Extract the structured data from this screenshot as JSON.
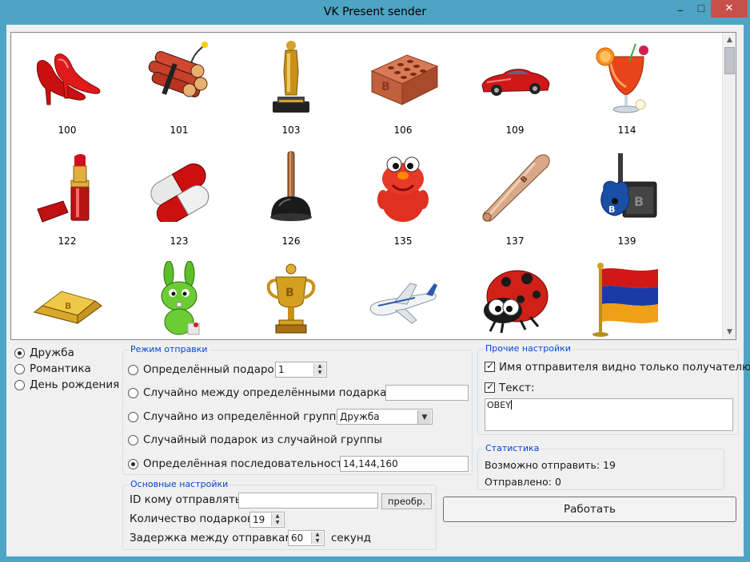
{
  "window": {
    "title": "VK Present sender",
    "min_glyph": "_",
    "max_glyph": "☐",
    "close_glyph": "✕"
  },
  "gifts": [
    {
      "id": "100",
      "icon": "red-heels-icon"
    },
    {
      "id": "101",
      "icon": "dynamite-icon"
    },
    {
      "id": "103",
      "icon": "oscar-statuette-icon"
    },
    {
      "id": "106",
      "icon": "brick-icon"
    },
    {
      "id": "109",
      "icon": "red-sports-car-icon"
    },
    {
      "id": "114",
      "icon": "cocktail-icon"
    },
    {
      "id": "122",
      "icon": "lipstick-icon"
    },
    {
      "id": "123",
      "icon": "pill-capsule-icon"
    },
    {
      "id": "126",
      "icon": "plunger-icon"
    },
    {
      "id": "135",
      "icon": "red-plush-monster-icon"
    },
    {
      "id": "137",
      "icon": "baseball-bat-icon"
    },
    {
      "id": "139",
      "icon": "guitar-amp-icon"
    },
    {
      "id": "",
      "icon": "gold-bar-icon"
    },
    {
      "id": "",
      "icon": "green-bunny-icon"
    },
    {
      "id": "",
      "icon": "gold-cup-icon"
    },
    {
      "id": "",
      "icon": "airplane-icon"
    },
    {
      "id": "",
      "icon": "ladybug-icon"
    },
    {
      "id": "",
      "icon": "armenian-flag-icon"
    }
  ],
  "categories": [
    {
      "label": "Дружба",
      "checked": true
    },
    {
      "label": "Романтика",
      "checked": false
    },
    {
      "label": "День рождения",
      "checked": false
    }
  ],
  "send_mode": {
    "legend": "Режим отправки",
    "options": [
      {
        "label": "Определённый подарок",
        "checked": false
      },
      {
        "label": "Случайно между определёнными подарками",
        "checked": false
      },
      {
        "label": "Случайно из определённой группы",
        "checked": false
      },
      {
        "label": "Случайный подарок из случайной группы",
        "checked": false
      },
      {
        "label": "Определённая последовательность",
        "checked": true
      }
    ],
    "gift_value": "1",
    "random_between_value": "",
    "group_value": "Дружба",
    "sequence_value": "14,144,160"
  },
  "main_settings": {
    "legend": "Основные настройки",
    "id_label": "ID кому отправлять",
    "id_value": "",
    "convert_button": "преобр.",
    "count_label": "Количество подарков",
    "count_value": "19",
    "delay_label": "Задержка между отправками",
    "delay_value": "60",
    "delay_unit": "секунд"
  },
  "other_settings": {
    "legend": "Прочие настройки",
    "sender_visible_label": "Имя отправителя видно только получателю",
    "sender_visible_checked": true,
    "text_label": "Текст:",
    "text_checked": true,
    "text_value": "OBEY"
  },
  "stats": {
    "legend": "Статистика",
    "can_send": "Возможно отправить: 19",
    "sent": "Отправлено: 0"
  },
  "work_button": "Работать",
  "colors": {
    "titlebar": "#4ea4c4",
    "close": "#c7504b",
    "legend": "#0046d5",
    "face": "#f0f0f0"
  }
}
